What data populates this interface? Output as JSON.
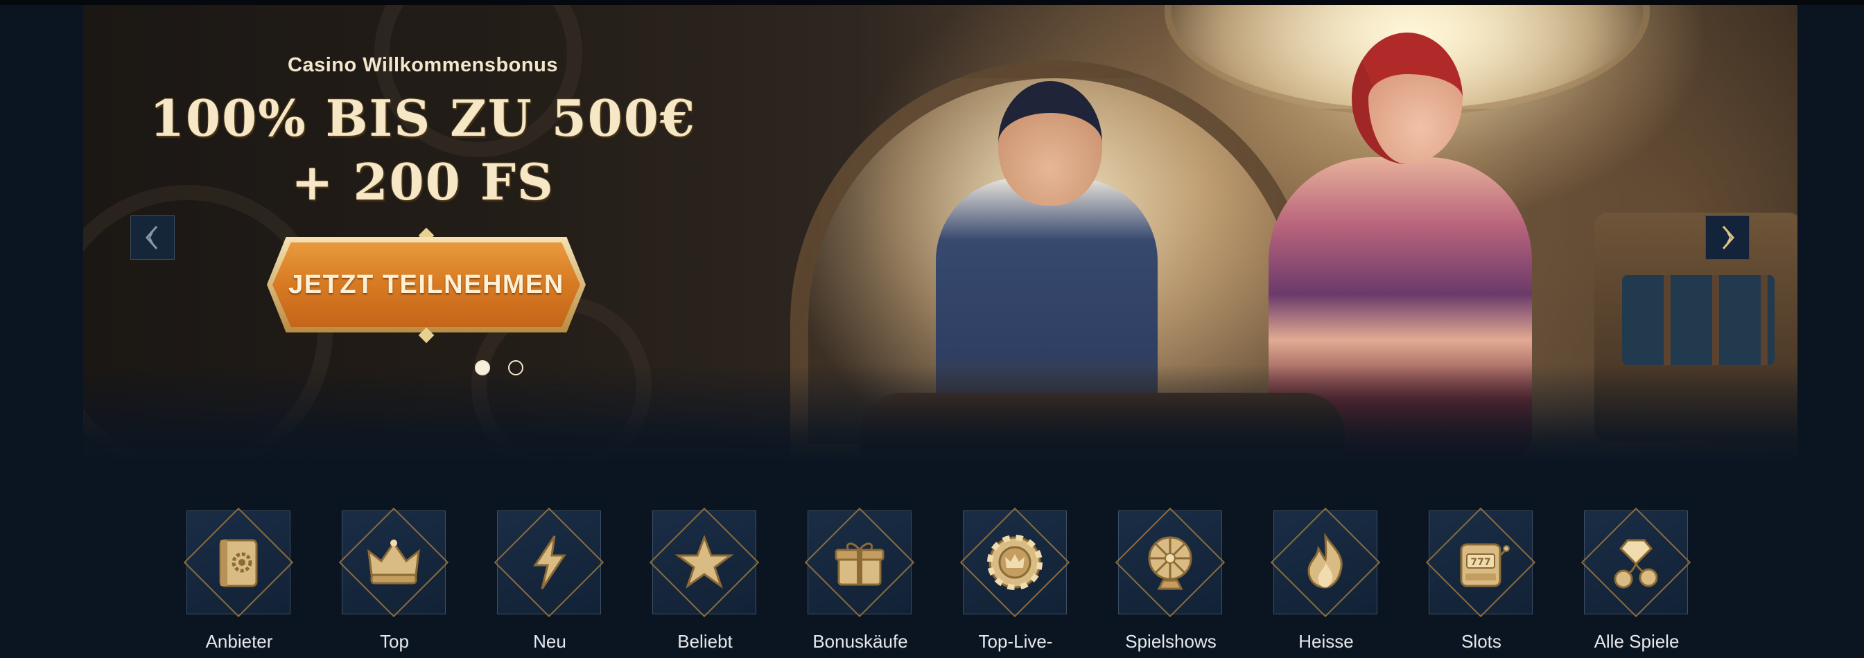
{
  "banner": {
    "subtitle": "Casino Willkommensbonus",
    "title": "100% BIS ZU 500€ + 200 FS",
    "cta_label": "JETZT TEILNEHMEN",
    "slides": {
      "count": 2,
      "active": 1
    },
    "prev_icon": "chevron-left-icon",
    "next_icon": "chevron-right-icon"
  },
  "categories": [
    {
      "label": "Anbieter",
      "icon": "book-gear-icon"
    },
    {
      "label": "Top",
      "icon": "crown-icon"
    },
    {
      "label": "Neu",
      "icon": "lightning-icon"
    },
    {
      "label": "Beliebt",
      "icon": "star-icon"
    },
    {
      "label": "Bonuskäufe",
      "icon": "gift-box-icon"
    },
    {
      "label": "Top-Live-",
      "icon": "poker-chip-crown-icon"
    },
    {
      "label": "Spielshows",
      "icon": "prize-wheel-icon"
    },
    {
      "label": "Heisse",
      "icon": "flame-icon"
    },
    {
      "label": "Slots",
      "icon": "slot-machine-icon"
    },
    {
      "label": "Alle Spiele",
      "icon": "diamond-cherries-icon"
    }
  ],
  "colors": {
    "background": "#0b1522",
    "cta": "#d77a22",
    "gold": "#c9a66b",
    "text_light": "#e6e8ec"
  }
}
